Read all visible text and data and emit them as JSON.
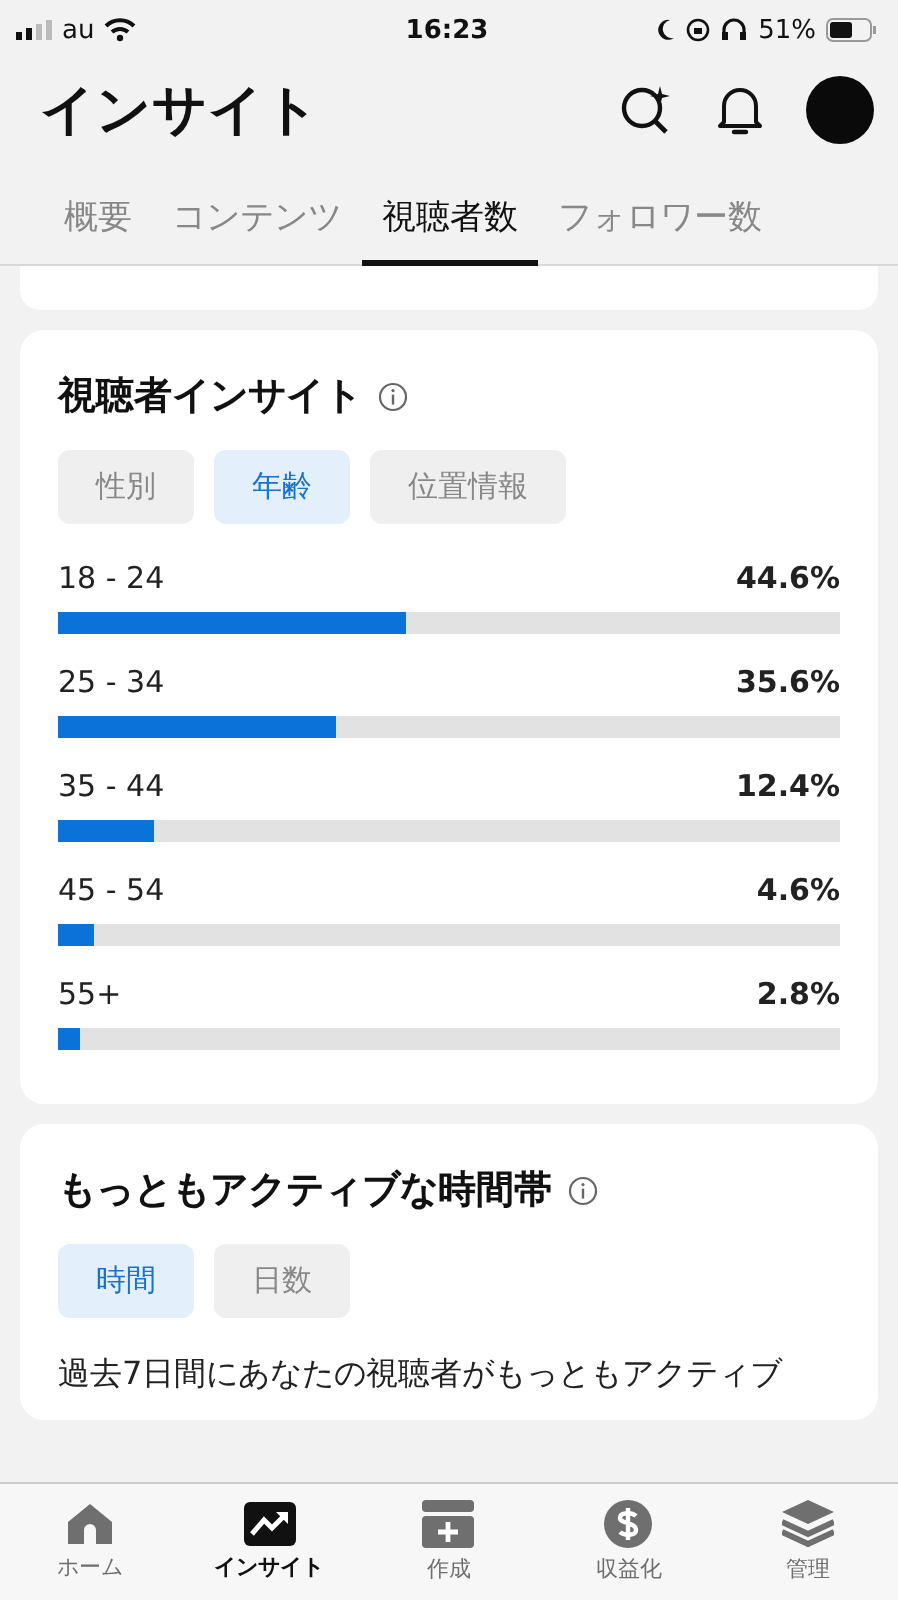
{
  "status_bar": {
    "carrier": "au",
    "time": "16:23",
    "battery": "51%"
  },
  "header": {
    "title": "インサイト"
  },
  "tabs": [
    {
      "label": "概要",
      "selected": false
    },
    {
      "label": "コンテンツ",
      "selected": false
    },
    {
      "label": "視聴者数",
      "selected": true
    },
    {
      "label": "フォロワー数",
      "selected": false
    }
  ],
  "audience_card": {
    "title": "視聴者インサイト",
    "filters": [
      {
        "label": "性別",
        "selected": false
      },
      {
        "label": "年齢",
        "selected": true
      },
      {
        "label": "位置情報",
        "selected": false
      }
    ],
    "rows": [
      {
        "label": "18 - 24",
        "value": "44.6%",
        "level": 0.446
      },
      {
        "label": "25 - 34",
        "value": "35.6%",
        "level": 0.356
      },
      {
        "label": "35 - 44",
        "value": "12.4%",
        "level": 0.124
      },
      {
        "label": "45 - 54",
        "value": "4.6%",
        "level": 0.046
      },
      {
        "label": "55+",
        "value": "2.8%",
        "level": 0.028
      }
    ]
  },
  "active_card": {
    "title": "もっともアクティブな時間帯",
    "filters": [
      {
        "label": "時間",
        "selected": true
      },
      {
        "label": "日数",
        "selected": false
      }
    ],
    "description": "過去7日間にあなたの視聴者がもっともアクティブ"
  },
  "bottom_nav": [
    {
      "label": "ホーム",
      "selected": false
    },
    {
      "label": "インサイト",
      "selected": true
    },
    {
      "label": "作成",
      "selected": false
    },
    {
      "label": "収益化",
      "selected": false
    },
    {
      "label": "管理",
      "selected": false
    }
  ]
}
